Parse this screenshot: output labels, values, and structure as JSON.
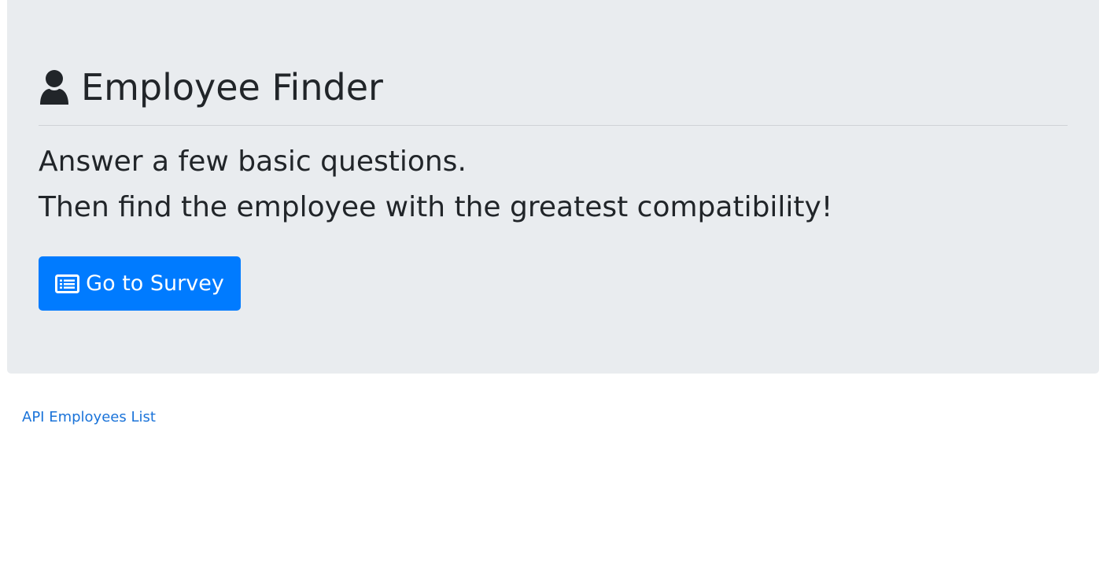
{
  "header": {
    "icon": "user-icon",
    "title": "Employee Finder"
  },
  "lead": {
    "line1": "Answer a few basic questions.",
    "line2": "Then find the employee with the greatest compatibility!"
  },
  "survey_button": {
    "icon": "list-alt-icon",
    "label": "Go to Survey"
  },
  "footer": {
    "api_link": "API Employees List"
  },
  "colors": {
    "jumbotron_bg": "#e9ecef",
    "primary": "#007bff",
    "text": "#212529",
    "link": "#1a73d9"
  }
}
